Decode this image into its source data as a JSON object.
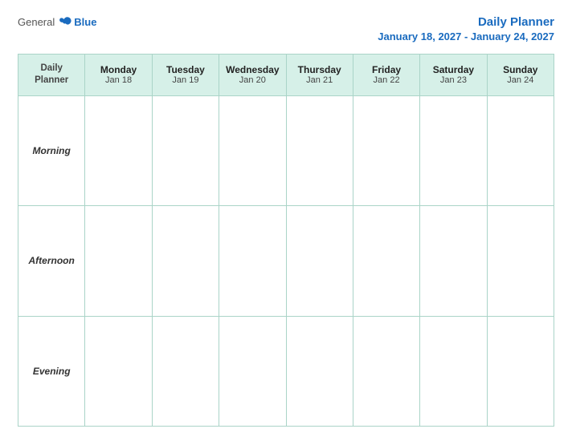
{
  "header": {
    "logo": {
      "general": "General",
      "blue": "Blue",
      "icon_alt": "GeneralBlue logo"
    },
    "title": "Daily Planner",
    "date_range": "January 18, 2027 - January 24, 2027"
  },
  "table": {
    "header_row": [
      {
        "id": "daily-planner-col",
        "day": "Daily",
        "day2": "Planner",
        "date": ""
      },
      {
        "id": "monday-col",
        "day": "Monday",
        "date": "Jan 18"
      },
      {
        "id": "tuesday-col",
        "day": "Tuesday",
        "date": "Jan 19"
      },
      {
        "id": "wednesday-col",
        "day": "Wednesday",
        "date": "Jan 20"
      },
      {
        "id": "thursday-col",
        "day": "Thursday",
        "date": "Jan 21"
      },
      {
        "id": "friday-col",
        "day": "Friday",
        "date": "Jan 22"
      },
      {
        "id": "saturday-col",
        "day": "Saturday",
        "date": "Jan 23"
      },
      {
        "id": "sunday-col",
        "day": "Sunday",
        "date": "Jan 24"
      }
    ],
    "rows": [
      {
        "id": "morning",
        "label": "Morning"
      },
      {
        "id": "afternoon",
        "label": "Afternoon"
      },
      {
        "id": "evening",
        "label": "Evening"
      }
    ]
  }
}
